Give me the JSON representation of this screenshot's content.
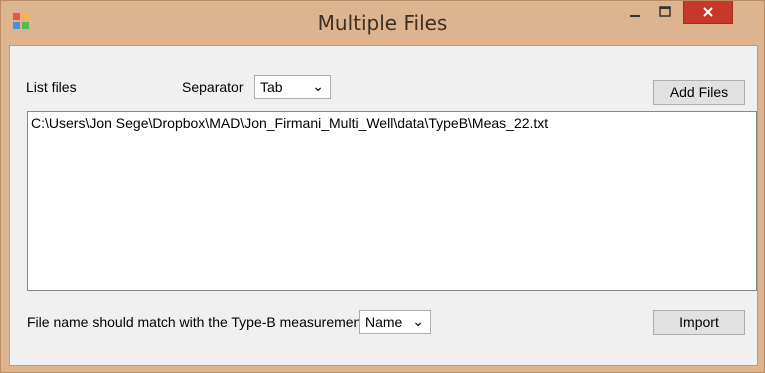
{
  "window": {
    "title": "Multiple Files",
    "controls": {
      "minimize": "–",
      "maximize": "□",
      "close": "✕"
    }
  },
  "list_files_label": "List files",
  "separator": {
    "label": "Separator",
    "value": "Tab",
    "arrow": "⌄"
  },
  "add_files_button": "Add Files",
  "file_list": [
    "C:\\Users\\Jon Sege\\Dropbox\\MAD\\Jon_Firmani_Multi_Well\\data\\TypeB\\Meas_22.txt"
  ],
  "match": {
    "label": "File name should match with the Type-B measurement",
    "value": "Name",
    "arrow": "⌄"
  },
  "import_button": "Import"
}
